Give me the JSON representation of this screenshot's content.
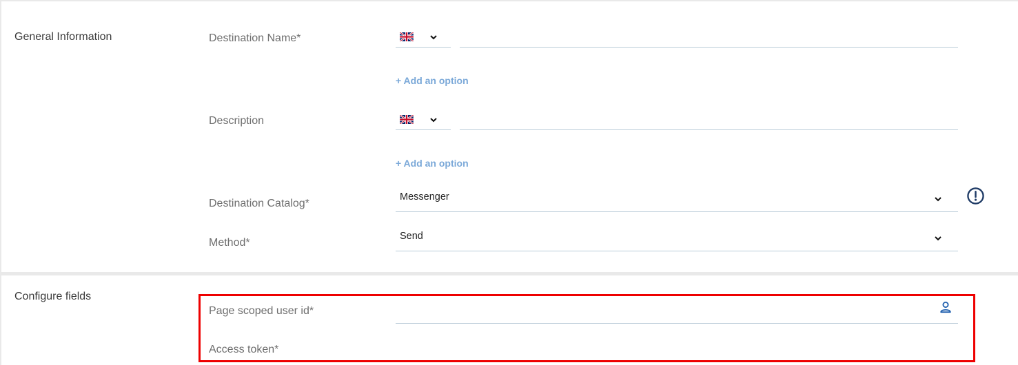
{
  "general": {
    "section_title": "General Information",
    "destination_name": {
      "label": "Destination Name*",
      "language_flag": "uk-flag-icon",
      "value": "",
      "add_option": "+ Add an option"
    },
    "description": {
      "label": "Description",
      "language_flag": "uk-flag-icon",
      "value": "",
      "add_option": "+ Add an option"
    },
    "destination_catalog": {
      "label": "Destination Catalog*",
      "selected": "Messenger",
      "info_icon": "info-circle-icon"
    },
    "method": {
      "label": "Method*",
      "selected": "Send"
    }
  },
  "configure": {
    "section_title": "Configure fields",
    "page_scoped_user_id": {
      "label": "Page scoped user id*",
      "value": "",
      "icon": "user-icon"
    },
    "access_token": {
      "label": "Access token*",
      "value": ""
    }
  },
  "colors": {
    "link": "#7aa8d8",
    "icon_blue": "#1f5fae",
    "highlight": "#ee0000",
    "underline": "#b9cbd8"
  }
}
